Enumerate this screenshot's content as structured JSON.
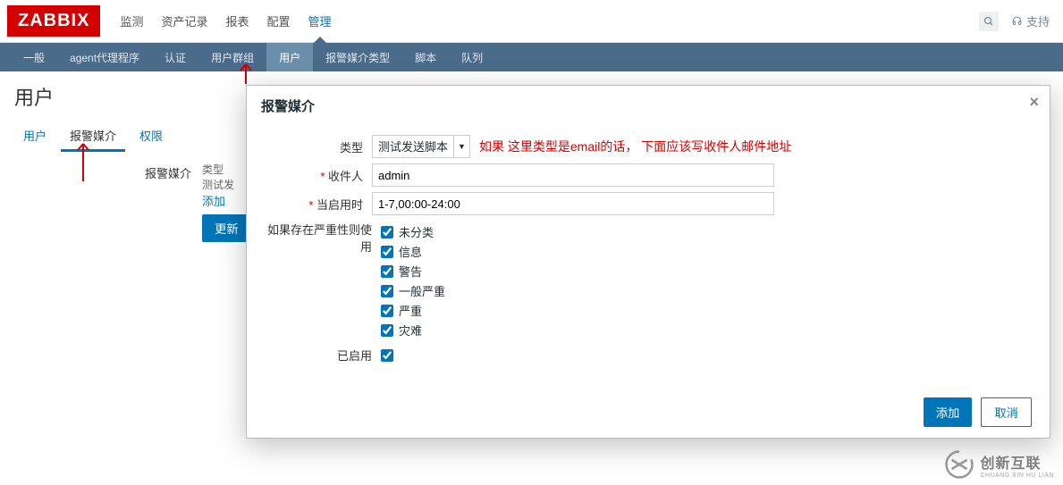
{
  "logo": "ZABBIX",
  "top_nav": [
    "监测",
    "资产记录",
    "报表",
    "配置",
    "管理"
  ],
  "top_nav_active": 4,
  "support": "支持",
  "sub_nav": [
    "一般",
    "agent代理程序",
    "认证",
    "用户群组",
    "用户",
    "报警媒介类型",
    "脚本",
    "队列"
  ],
  "sub_nav_active": 4,
  "page_title": "用户",
  "tabs": [
    "用户",
    "报警媒介",
    "权限"
  ],
  "tabs_selected": 1,
  "form": {
    "label_media": "报警媒介",
    "col_type": "类型",
    "row_testsend": "测试发",
    "link_add": "添加",
    "btn_update": "更新"
  },
  "modal": {
    "title": "报警媒介",
    "label_type": "类型",
    "select_value": "测试发送脚本",
    "annotation": "如果 这里类型是email的话， 下面应该写收件人邮件地址",
    "label_recipient": "收件人",
    "value_recipient": "admin",
    "label_when": "当启用时",
    "value_when": "1-7,00:00-24:00",
    "label_severity": "如果存在严重性则使用",
    "severities": [
      "未分类",
      "信息",
      "警告",
      "一般严重",
      "严重",
      "灾难"
    ],
    "label_enabled": "已启用",
    "btn_add": "添加",
    "btn_cancel": "取消"
  },
  "watermark": {
    "cn": "创新互联",
    "en": "CHUANG XIN HU LIAN"
  }
}
